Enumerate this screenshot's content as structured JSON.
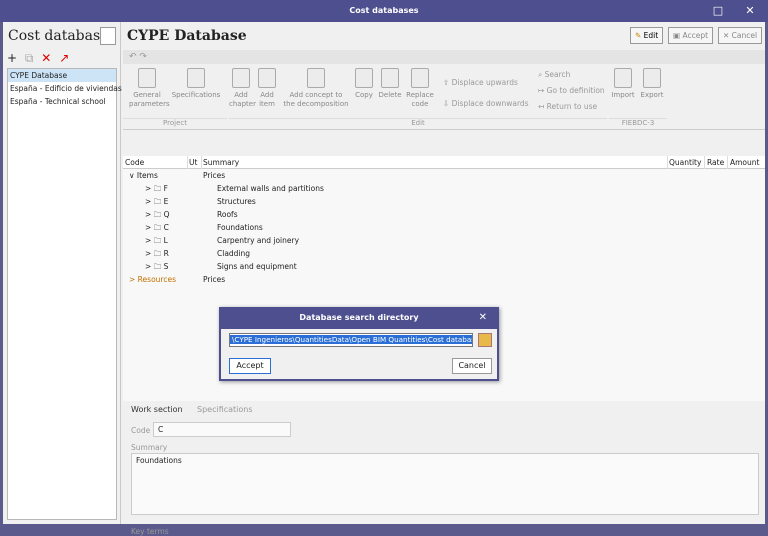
{
  "window": {
    "title": "Cost databases",
    "minimize": "□",
    "close": "✕"
  },
  "left": {
    "title": "Cost databases",
    "items": [
      "CYPE Database",
      "España - Edificio de viviendas",
      "España - Technical school"
    ]
  },
  "right": {
    "title": "CYPE Database",
    "edit": "Edit",
    "accept": "Accept",
    "cancel": "Cancel"
  },
  "ribbon": {
    "general": "General",
    "parameters": "parameters",
    "specifications": "Specifications",
    "add": "Add",
    "chapter": "chapter",
    "item": "item",
    "add_concept": "Add concept to",
    "decomposition": "the decomposition",
    "copy": "Copy",
    "delete": "Delete",
    "replace": "Replace",
    "code": "code",
    "up": "Displace upwards",
    "down": "Displace downwards",
    "search": "Search",
    "go_def": "Go to definition",
    "return": "Return to use",
    "import": "Import",
    "export": "Export",
    "g_project": "Project",
    "g_edit": "Edit",
    "g_fie": "FIEBDC-3"
  },
  "table": {
    "code": "Code",
    "ut": "Ut",
    "summary": "Summary",
    "quantity": "Quantity",
    "rate": "Rate",
    "amount": "Amount"
  },
  "tree": {
    "items_label": "Items",
    "items_summary": "Prices",
    "rows": [
      [
        "F",
        "External walls and partitions"
      ],
      [
        "E",
        "Structures"
      ],
      [
        "Q",
        "Roofs"
      ],
      [
        "C",
        "Foundations"
      ],
      [
        "L",
        "Carpentry and joinery"
      ],
      [
        "R",
        "Cladding"
      ],
      [
        "S",
        "Signs and equipment"
      ]
    ],
    "resources_label": "Resources",
    "resources_summary": "Prices"
  },
  "bottom": {
    "tab_work": "Work section",
    "tab_spec": "Specifications",
    "code_label": "Code",
    "code_value": "C",
    "summary_label": "Summary",
    "summary_value": "Foundations",
    "key_label": "Key terms"
  },
  "dialog": {
    "title": "Database search directory",
    "close": "✕",
    "path": "\\CYPE Ingenieros\\QuantitiesData\\Open BIM Quantities\\Cost databases",
    "accept": "Accept",
    "cancel": "Cancel"
  },
  "colors": {
    "titlebar": "#4e4f8f",
    "selection": "#cde4f7",
    "highlight": "#2b6fd6",
    "resources": "#c07000"
  }
}
